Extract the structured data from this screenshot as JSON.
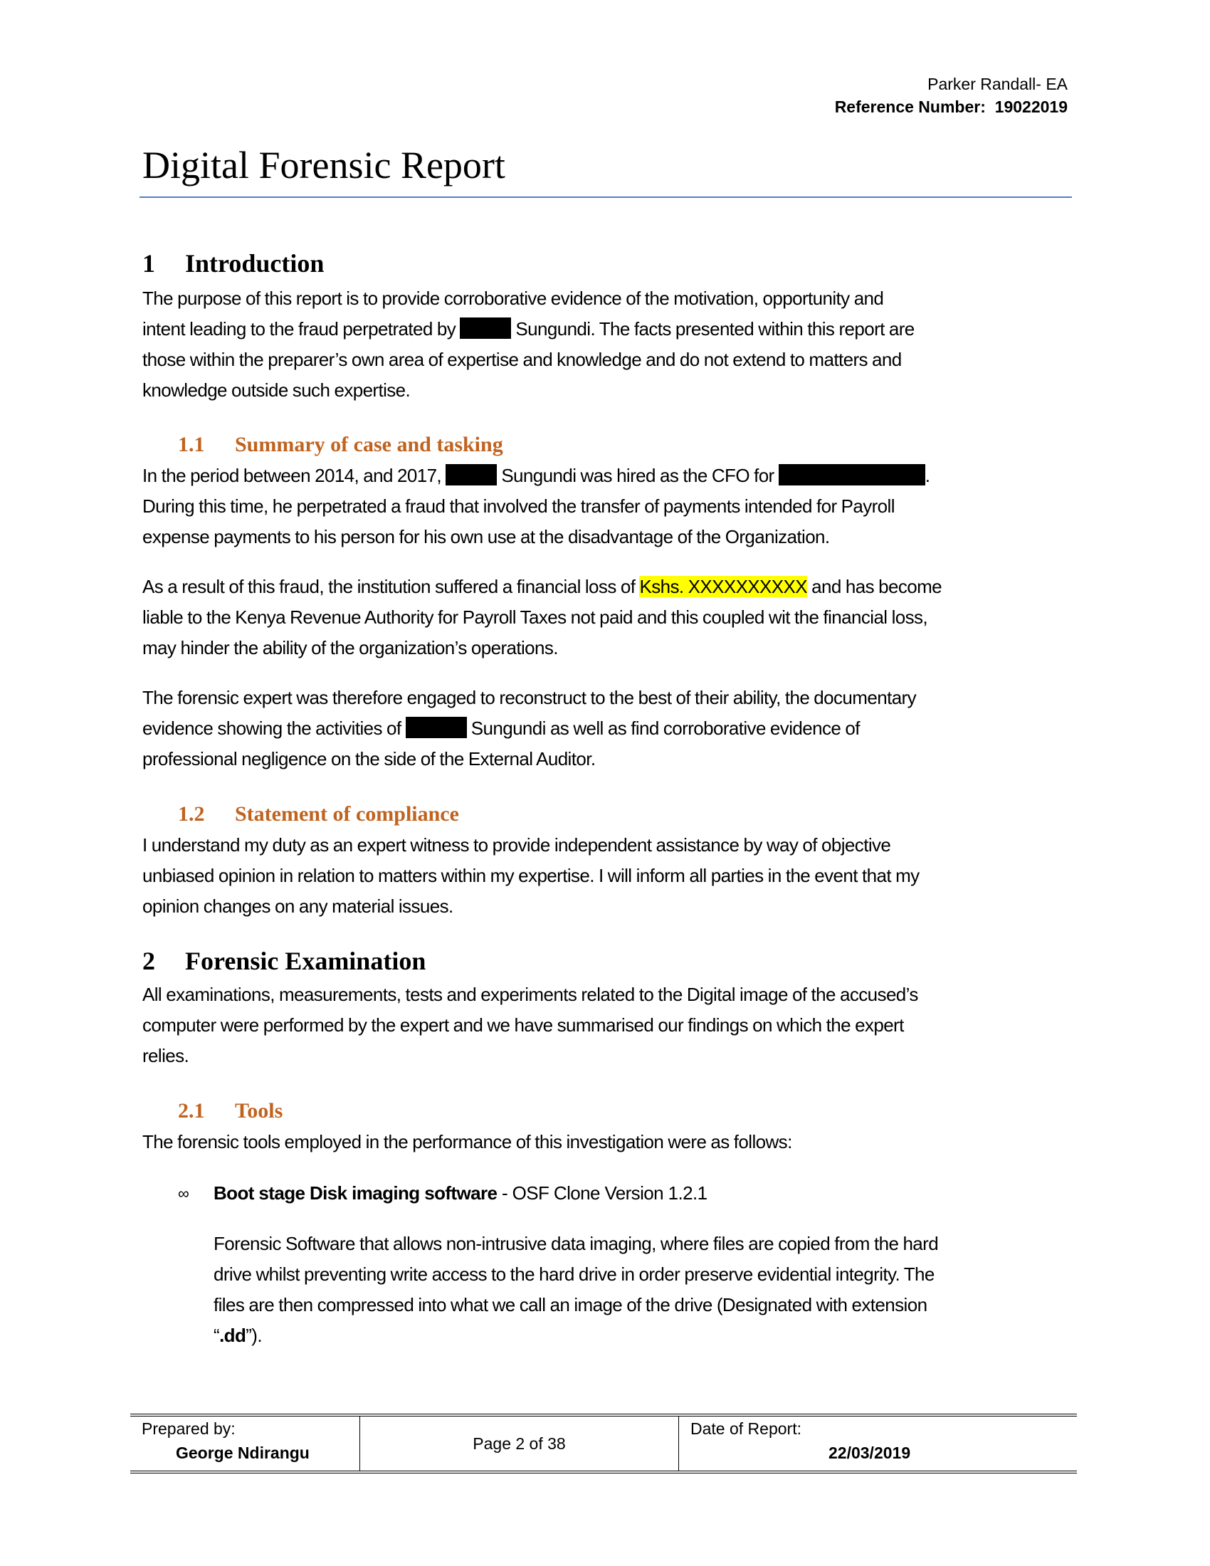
{
  "header": {
    "author": "Parker Randall- EA",
    "reference_label": "Reference Number:",
    "reference_number": "19022019"
  },
  "title": "Digital Forensic Report",
  "sections": {
    "intro": {
      "number": "1",
      "title": "Introduction",
      "para": {
        "l1": "The purpose of this report is to provide corroborative evidence of the motivation, opportunity and",
        "l2a": "intent leading to the fraud perpetrated by",
        "l2b": "Sungundi. The facts presented within this report are",
        "l3": "those within the preparer’s own area of expertise and knowledge and do not extend to matters and",
        "l4": "knowledge outside such expertise."
      }
    },
    "summary": {
      "number": "1.1",
      "title": "Summary of case and tasking",
      "p1": {
        "l1a": "In the period between 2014, and 2017,",
        "l1b": "Sungundi was hired as the CFO for",
        "l1c": ".",
        "l2": "During this time, he perpetrated a fraud that involved the transfer of payments intended for Payroll",
        "l3": "expense payments to his person for his own use at the disadvantage of the Organization."
      },
      "p2": {
        "l1a": "As a result of this fraud, the institution suffered a financial loss of",
        "l1_highlight": "Kshs. XXXXXXXXXX",
        "l1b": "and has become",
        "l2": "liable to the Kenya Revenue Authority for Payroll Taxes not paid and this coupled wit the financial loss,",
        "l3": "may hinder the ability of the organization’s operations."
      },
      "p3": {
        "l1": "The forensic expert was therefore engaged to reconstruct to the best of their ability, the documentary",
        "l2a": "evidence showing the activities of",
        "l2b": "Sungundi as well as find corroborative evidence of",
        "l3": "professional negligence on the side of the External Auditor."
      }
    },
    "compliance": {
      "number": "1.2",
      "title": "Statement of compliance",
      "para": {
        "l1": "I understand my duty as an expert witness to provide independent assistance by way of objective",
        "l2": "unbiased opinion in relation to matters within my expertise. I will inform all parties in the event that my",
        "l3": "opinion changes on any material issues."
      }
    },
    "exam": {
      "number": "2",
      "title": "Forensic Examination",
      "para": {
        "l1": "All examinations, measurements, tests and experiments related to the Digital image of the accused’s",
        "l2": "computer were performed by the expert and we have summarised our findings on which the expert",
        "l3": "relies."
      }
    },
    "tools": {
      "number": "2.1",
      "title": "Tools",
      "intro": "The forensic tools employed in the performance of this investigation were as follows:",
      "items": [
        {
          "bullet": "∞",
          "name": "Boot stage Disk imaging software",
          "detail": " - OSF Clone Version 1.2.1",
          "desc": {
            "l1": "Forensic Software that allows non-intrusive data imaging, where files are copied from the hard",
            "l2": "drive whilst preventing write access to the hard drive in order preserve evidential integrity. The",
            "l3": "files are then compressed into what we call an image of the drive (Designated with extension",
            "l4_open": "“",
            "l4_bold": ".dd",
            "l4_close": "”)."
          }
        }
      ]
    }
  },
  "footer": {
    "prepared_label": "Prepared by:",
    "prepared_name": "George Ndirangu",
    "page": "Page 2 of 38",
    "date_label": "Date of Report:",
    "date": "22/03/2019"
  },
  "colors": {
    "heading2": "#c0631f",
    "title_rule": "#4f81bd",
    "highlight": "#ffff00",
    "redaction": "#000000"
  }
}
